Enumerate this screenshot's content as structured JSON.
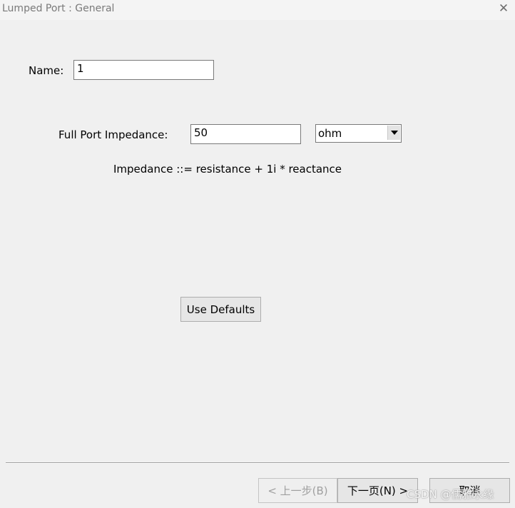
{
  "window": {
    "title": "Lumped Port : General",
    "close_glyph": "✕"
  },
  "form": {
    "name_label": "Name:",
    "name_value": "1",
    "impedance_label": "Full Port Impedance:",
    "impedance_value": "50",
    "unit_selected": "ohm",
    "formula_text": "Impedance ::= resistance + 1i * reactance",
    "use_defaults_label": "Use Defaults"
  },
  "footer": {
    "back_label": "< 上一步(B)",
    "next_label": "下一页(N) >",
    "cancel_label": "取消"
  },
  "watermark": "CSDN @儒雅永缘",
  "icons": {
    "close": "close-icon",
    "dropdown": "chevron-down-icon"
  },
  "colors": {
    "background": "#f0f0f0",
    "title_text": "#7a7a7a",
    "disabled_text": "#a0a0a0"
  }
}
